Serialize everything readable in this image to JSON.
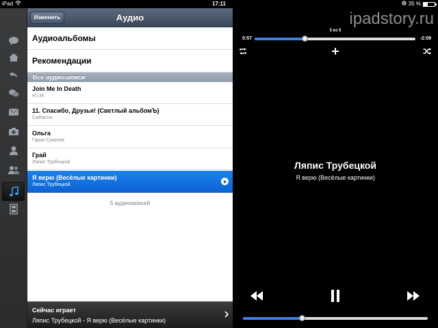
{
  "status_bar": {
    "device": "iPad",
    "time": "17:11",
    "battery": "35 %",
    "battery_level": 0.35
  },
  "sidebar_rail": {
    "items": [
      {
        "icon": "chat-bubble-icon"
      },
      {
        "icon": "home-icon"
      },
      {
        "icon": "back-arrow-icon"
      },
      {
        "icon": "conversations-icon"
      },
      {
        "icon": "mail-icon"
      },
      {
        "icon": "camera-icon"
      },
      {
        "icon": "person-icon"
      },
      {
        "icon": "friends-icon"
      },
      {
        "icon": "music-note-icon",
        "active": true
      },
      {
        "icon": "film-icon"
      }
    ]
  },
  "navbar": {
    "edit_label": "Изменить",
    "title": "Аудио"
  },
  "menu": {
    "albums": "Аудиоальбомы",
    "recommendations": "Рекомендации"
  },
  "section": {
    "all_audio": "Все аудиозаписи"
  },
  "songs": [
    {
      "title": "Join Me In Death",
      "artist": "H.I.M"
    },
    {
      "title": "11. Спасибо, Друзья! (Светлый альбомЪ)",
      "artist": "Catharsis"
    },
    {
      "title": "Ольга",
      "artist": "Гарик Сукачев"
    },
    {
      "title": "Грай",
      "artist": "Ляпис Трубецкой"
    },
    {
      "title": "Я верю (Весёлые картинки)",
      "artist": "Ляпис Трубецкой",
      "playing": true
    }
  ],
  "song_count": "5 аудиозаписей",
  "now_playing_bar": {
    "label": "Сейчас играет",
    "value": "Ляпис Трубецкой - Я верю (Весёлые картинки)"
  },
  "player": {
    "watermark": "ipadstory.ru",
    "track_position": "5 из 5",
    "elapsed": "0:57",
    "remaining": "-2:09",
    "progress": 0.31,
    "artist": "Ляпис Трубецкой",
    "song": "Я верю (Весёлые картинки)",
    "volume": 0.32,
    "colors": {
      "accent": "#3b82e8",
      "selection": "#1b82e8"
    }
  }
}
